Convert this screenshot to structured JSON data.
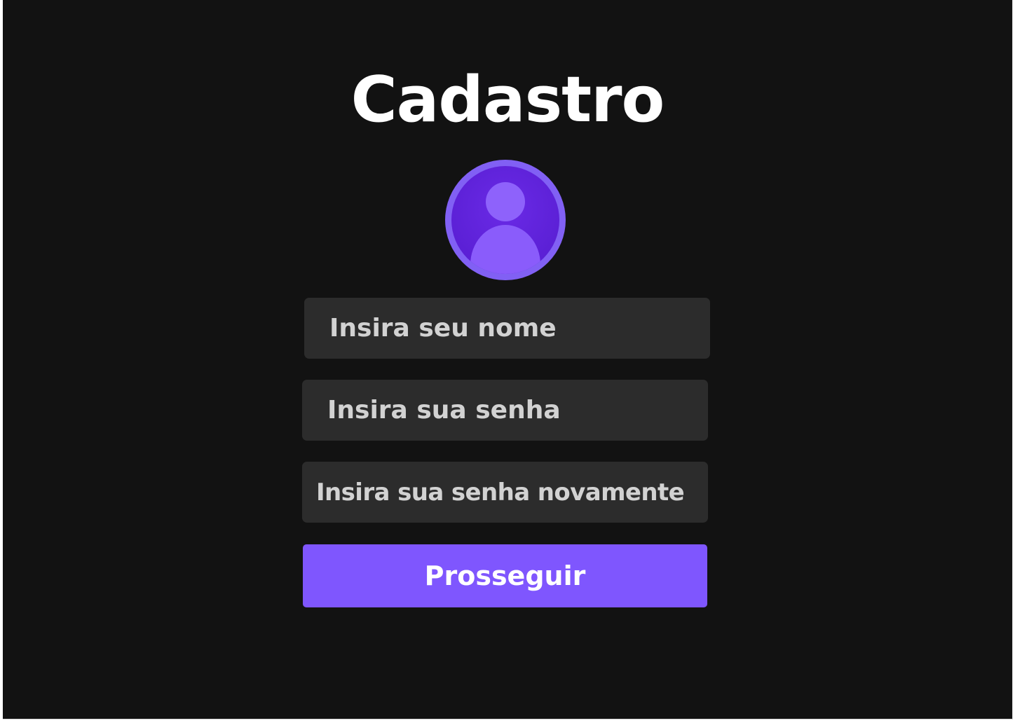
{
  "page": {
    "title": "Cadastro"
  },
  "avatar": {
    "icon": "user-avatar-icon"
  },
  "form": {
    "name_placeholder": "Insira seu nome",
    "password_placeholder": "Insira sua senha",
    "confirm_password_placeholder": "Insira sua senha novamente",
    "submit_label": "Prosseguir"
  },
  "colors": {
    "background": "#121212",
    "field_background": "#2c2c2c",
    "accent": "#7f56fe",
    "avatar_outer": "#7f56fe",
    "avatar_inner": "#5b1fd6"
  }
}
